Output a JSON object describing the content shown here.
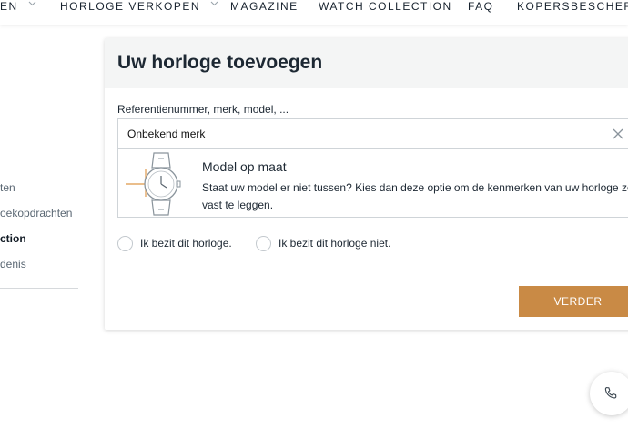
{
  "nav": {
    "items": [
      {
        "label": "EN",
        "has_dropdown": true
      },
      {
        "label": "HORLOGE VERKOPEN",
        "has_dropdown": true
      },
      {
        "label": "MAGAZINE",
        "has_dropdown": false
      },
      {
        "label": "WATCH COLLECTION",
        "has_dropdown": false
      },
      {
        "label": "FAQ",
        "has_dropdown": false
      },
      {
        "label": "KOPERSBESCHERM",
        "has_dropdown": false
      }
    ]
  },
  "sidebar": {
    "items": [
      {
        "label": "ten",
        "active": false
      },
      {
        "label": "oekopdrachten",
        "active": false
      },
      {
        "label": "ction",
        "active": true
      },
      {
        "label": "denis",
        "active": false
      }
    ]
  },
  "card": {
    "title": "Uw horloge toevoegen",
    "search_label": "Referentienummer, merk, model, ...",
    "search_value": "Onbekend merk",
    "suggestion": {
      "title": "Model op maat",
      "text": "Staat uw model er niet tussen? Kies dan deze optie om de kenmerken van uw horloge zelf vast te leggen."
    },
    "ownership_options": [
      "Ik bezit dit horloge.",
      "Ik bezit dit horloge niet."
    ],
    "next_label": "VERDER"
  },
  "colors": {
    "accent": "#c98a45",
    "text": "#1d2833",
    "header_bg": "#f4f5f5"
  },
  "icons": {
    "clear": "close-icon",
    "suggestion": "watch-icon",
    "fab": "phone-icon",
    "dropdown": "chevron-down-icon"
  }
}
